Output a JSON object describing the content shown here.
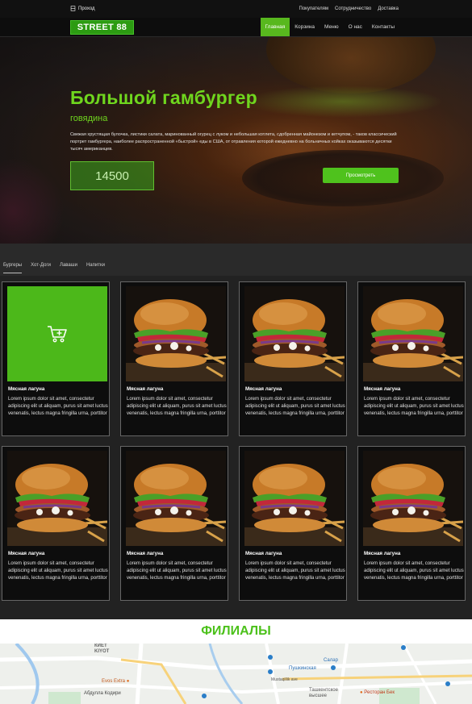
{
  "topbar": {
    "login_label": "Проход",
    "links": [
      "Покупателям",
      "Сотрудничество",
      "Доставка"
    ]
  },
  "logo": "STREET 88",
  "nav": [
    "Главная",
    "Корзина",
    "Меню",
    "О нас",
    "Контакты"
  ],
  "hero": {
    "title": "Большой гамбургер",
    "subtitle": "говядина",
    "description": "Свежая хрустящая булочка, листики салата, маринованный огурец с луком и небольшая котлета, сдобренная майонезом и кетчупом, - таков классический портрет гамбургера, наиболее распространенной «быстрой» еды в США, от отравления которой ежедневно на больничных койках оказываются десятки тысяч американцев.",
    "price": "14500",
    "button": "Просмотреть"
  },
  "tabs": [
    "Бургеры",
    "Хот-Доги",
    "Лаваши",
    "Напитки"
  ],
  "cards": [
    {
      "title": "Мясная лагуна",
      "text": "Lorem ipsum dolor sit amet, consectetur adipiscing elit ut aliquam, purus sit amet luctus venenatis, lectus magna fringilla urna, porttitor"
    },
    {
      "title": "Мясная лагуна",
      "text": "Lorem ipsum dolor sit amet, consectetur adipiscing elit ut aliquam, purus sit amet luctus venenatis, lectus magna fringilla urna, porttitor"
    },
    {
      "title": "Мясная лагуна",
      "text": "Lorem ipsum dolor sit amet, consectetur adipiscing elit ut aliquam, purus sit amet luctus venenatis, lectus magna fringilla urna, porttitor"
    },
    {
      "title": "Мясная лагуна",
      "text": "Lorem ipsum dolor sit amet, consectetur adipiscing elit ut aliquam, purus sit amet luctus venenatis, lectus magna fringilla urna, porttitor"
    },
    {
      "title": "Мясная лагуна",
      "text": "Lorem ipsum dolor sit amet, consectetur adipiscing elit ut aliquam, purus sit amet luctus venenatis, lectus magna fringilla urna, porttitor"
    },
    {
      "title": "Мясная лагуна",
      "text": "Lorem ipsum dolor sit amet, consectetur adipiscing elit ut aliquam, purus sit amet luctus venenatis, lectus magna fringilla urna, porttitor"
    },
    {
      "title": "Мясная лагуна",
      "text": "Lorem ipsum dolor sit amet, consectetur adipiscing elit ut aliquam, purus sit amet luctus venenatis, lectus magna fringilla urna, porttitor"
    },
    {
      "title": "Мясная лагуна",
      "text": "Lorem ipsum dolor sit amet, consectetur adipiscing elit ut aliquam, purus sit amet luctus venenatis, lectus magna fringilla urna, porttitor"
    }
  ],
  "branches_title": "ФИЛИАЛЫ",
  "map": {
    "district": "КИЕТ\nKIYOT",
    "labels": [
      "Evos Extra",
      "Абдулла Кодири",
      "Пушкинская",
      "Салар",
      "Ташкентское\nвысшее",
      "Ресторан Бек",
      "Mustaqillik ave"
    ]
  },
  "colors": {
    "accent": "#4cc11b",
    "nav_active": "#58b81e",
    "logo_bg": "#2c9b12"
  }
}
